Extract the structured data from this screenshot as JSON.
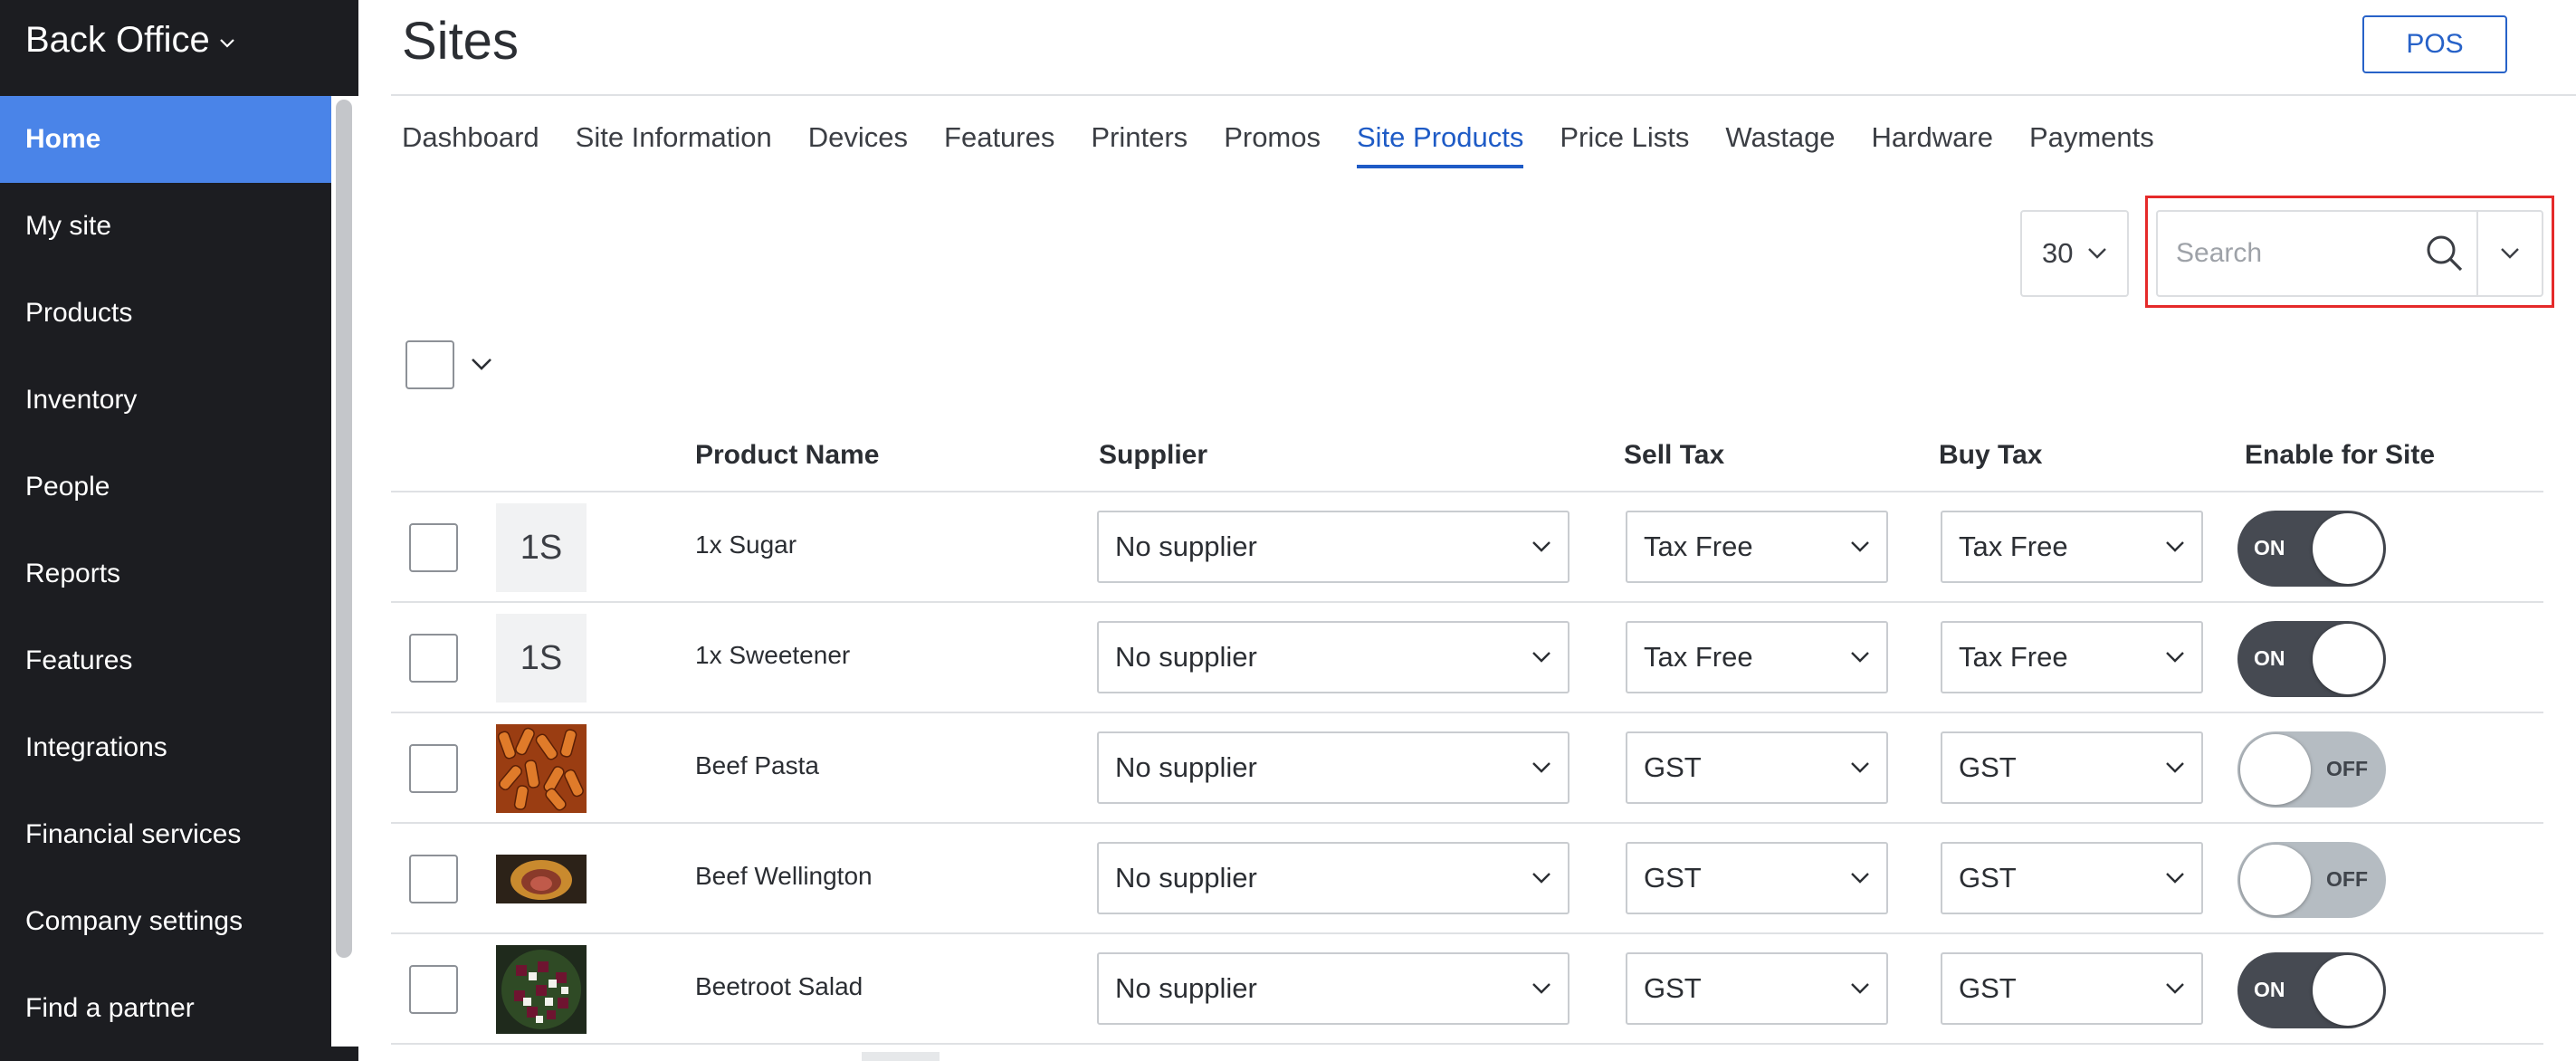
{
  "app": {
    "title": "Back Office"
  },
  "sidebar": {
    "items": [
      {
        "label": "Home",
        "active": true
      },
      {
        "label": "My site"
      },
      {
        "label": "Products"
      },
      {
        "label": "Inventory"
      },
      {
        "label": "People"
      },
      {
        "label": "Reports"
      },
      {
        "label": "Features"
      },
      {
        "label": "Integrations"
      },
      {
        "label": "Financial services"
      },
      {
        "label": "Company settings"
      },
      {
        "label": "Find a partner"
      }
    ]
  },
  "header": {
    "title": "Sites",
    "pos_label": "POS"
  },
  "tabs": [
    {
      "label": "Dashboard"
    },
    {
      "label": "Site Information"
    },
    {
      "label": "Devices"
    },
    {
      "label": "Features"
    },
    {
      "label": "Printers"
    },
    {
      "label": "Promos"
    },
    {
      "label": "Site Products",
      "active": true
    },
    {
      "label": "Price Lists"
    },
    {
      "label": "Wastage"
    },
    {
      "label": "Hardware"
    },
    {
      "label": "Payments"
    }
  ],
  "controls": {
    "per_page": "30",
    "search_placeholder": "Search"
  },
  "table": {
    "headers": {
      "product_name": "Product Name",
      "supplier": "Supplier",
      "sell_tax": "Sell Tax",
      "buy_tax": "Buy Tax",
      "enable": "Enable for Site"
    },
    "rows": [
      {
        "thumb": "1S",
        "thumb_type": "text",
        "name": "1x Sugar",
        "supplier": "No supplier",
        "sell_tax": "Tax Free",
        "buy_tax": "Tax Free",
        "enabled": "ON"
      },
      {
        "thumb": "1S",
        "thumb_type": "text",
        "name": "1x Sweetener",
        "supplier": "No supplier",
        "sell_tax": "Tax Free",
        "buy_tax": "Tax Free",
        "enabled": "ON"
      },
      {
        "thumb_type": "image",
        "name": "Beef Pasta",
        "supplier": "No supplier",
        "sell_tax": "GST",
        "buy_tax": "GST",
        "enabled": "OFF"
      },
      {
        "thumb_type": "image",
        "name": "Beef Wellington",
        "supplier": "No supplier",
        "sell_tax": "GST",
        "buy_tax": "GST",
        "enabled": "OFF"
      },
      {
        "thumb_type": "image",
        "name": "Beetroot Salad",
        "supplier": "No supplier",
        "sell_tax": "GST",
        "buy_tax": "GST",
        "enabled": "ON"
      }
    ]
  },
  "colors": {
    "accent": "#4a84e8",
    "active_tab": "#1e5bc6",
    "sidebar_bg": "#1c1d21",
    "highlight": "#e52a2a"
  }
}
